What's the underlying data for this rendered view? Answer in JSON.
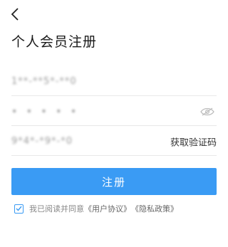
{
  "header": {
    "back_icon": "chevron-left-icon",
    "title": "个人会员注册"
  },
  "form": {
    "phone_value": "1**-**5*-**0",
    "password_value": "• • • • •",
    "password_toggle_icon": "eye-off-icon",
    "code_value": "9*4*-*9*-*0",
    "get_code_label": "获取验证码"
  },
  "actions": {
    "register_label": "注册",
    "accent_color": "#3a9bf4"
  },
  "agreement": {
    "checked": true,
    "prefix": "我已阅读并同意",
    "user_agreement": "《用户协议》",
    "privacy_policy": "《隐私政策》"
  }
}
